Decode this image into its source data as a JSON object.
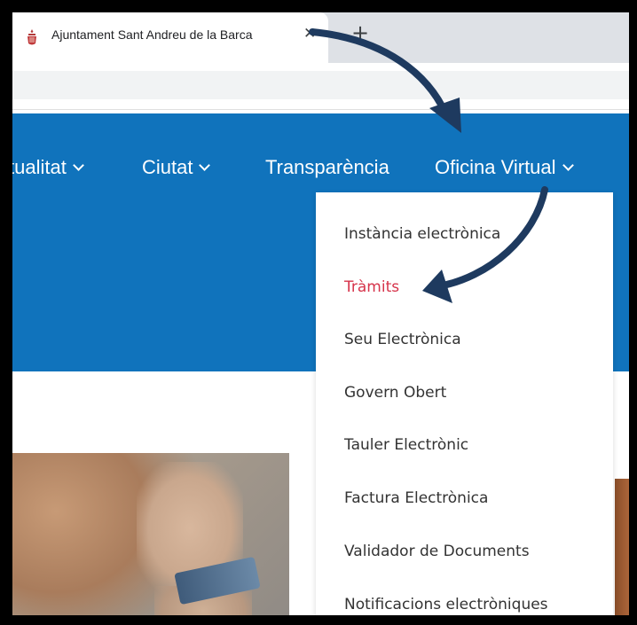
{
  "browser": {
    "tab_title": "Ajuntament Sant Andreu de la Barca",
    "close_glyph": "✕",
    "new_tab_glyph": "+",
    "favicon": "town-crest-icon"
  },
  "nav": {
    "items": [
      {
        "label": "tualitat",
        "dropdown": true
      },
      {
        "label": "Ciutat",
        "dropdown": true
      },
      {
        "label": "Transparència",
        "dropdown": false
      },
      {
        "label": "Oficina Virtual",
        "dropdown": true
      }
    ]
  },
  "dropdown": {
    "items": [
      {
        "label": "Instància electrònica"
      },
      {
        "label": "Tràmits",
        "active": true
      },
      {
        "label": "Seu Electrònica"
      },
      {
        "label": "Govern Obert"
      },
      {
        "label": "Tauler Electrònic"
      },
      {
        "label": "Factura Electrònica"
      },
      {
        "label": "Validador de Documents"
      },
      {
        "label": "Notificacions electròniques"
      }
    ]
  },
  "colors": {
    "nav_bg": "#1073bc",
    "active_item": "#d6334a",
    "arrow": "#1e3a5f"
  }
}
